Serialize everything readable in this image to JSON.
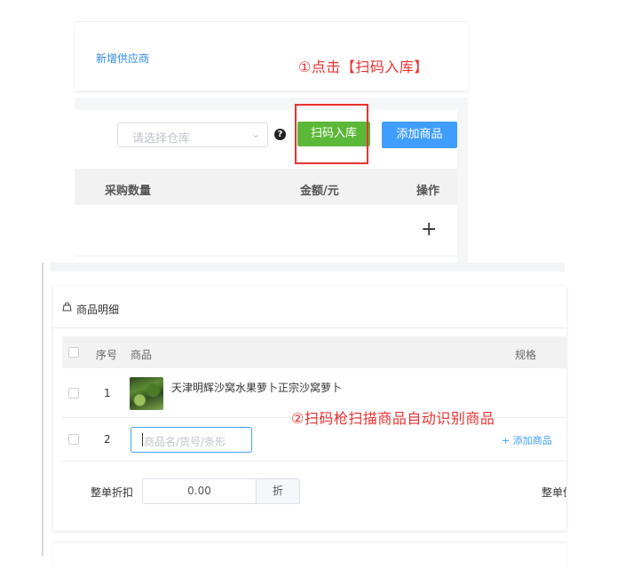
{
  "top": {
    "add_supplier_link": "新增供应商",
    "annotation_1": "①点击【扫码入库】",
    "warehouse_select_placeholder": "请选择仓库",
    "help_icon_glyph": "?",
    "scan_button": "扫码入库",
    "add_product_button": "添加商品",
    "columns": [
      "采购数量",
      "金额/元",
      "操作"
    ],
    "plus_glyph": "+"
  },
  "detail": {
    "section_title": "商品明细",
    "columns": [
      "序号",
      "商品",
      "规格"
    ],
    "rows": [
      {
        "index": "1",
        "product_name": "天津明辉沙窝水果萝卜正宗沙窝萝卜"
      },
      {
        "index": "2",
        "search_placeholder": "商品名/货号/条形",
        "add_link": "+ 添加商品"
      }
    ],
    "annotation_2": "②扫码枪扫描商品自动识别商品",
    "discount_label": "整单折扣",
    "discount_value": "0.00",
    "discount_suffix": "折",
    "cut_label": "整单优"
  },
  "colors": {
    "annotation": "#e8312f",
    "scan_button": "#5cb838",
    "primary": "#409eff"
  }
}
